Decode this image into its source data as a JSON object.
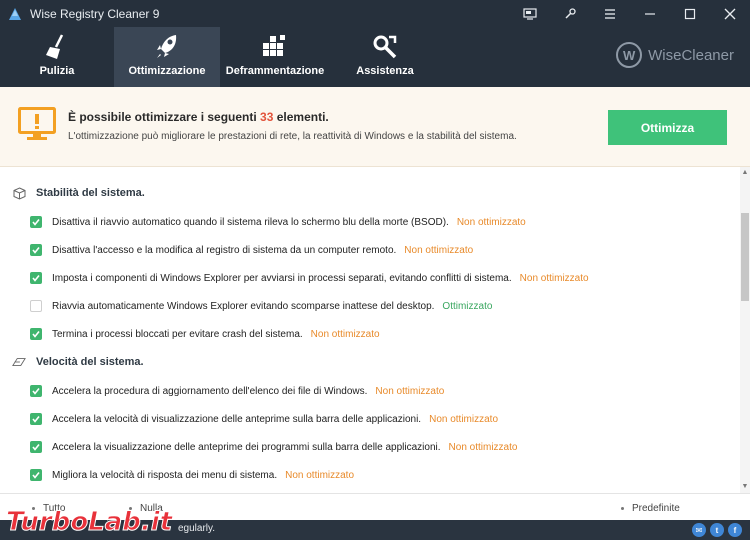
{
  "window": {
    "title": "Wise Registry Cleaner 9",
    "controls": [
      "monitor-icon",
      "skin-icon",
      "menu-icon",
      "minimize-icon",
      "maximize-icon",
      "close-icon"
    ]
  },
  "toolbar": {
    "tabs": [
      {
        "label": "Pulizia",
        "icon": "broom-icon"
      },
      {
        "label": "Ottimizzazione",
        "icon": "rocket-icon",
        "active": true
      },
      {
        "label": "Deframmentazione",
        "icon": "blocks-icon"
      },
      {
        "label": "Assistenza",
        "icon": "tools-icon"
      }
    ],
    "brand": {
      "mark": "W",
      "name": "WiseCleaner"
    }
  },
  "banner": {
    "headline_prefix": "È possibile ottimizzare i seguenti ",
    "count": "33",
    "headline_suffix": " elementi.",
    "description": "L'ottimizzazione può migliorare le prestazioni di rete, la reattività di Windows e la stabilità del sistema.",
    "button_label": "Ottimizza",
    "accent_color": "#3fc27a",
    "warning_color": "#f3a022"
  },
  "sections": [
    {
      "title": "Stabilità del sistema.",
      "icon": "cube-icon",
      "items": [
        {
          "text": "Disattiva il riavvio automatico quando il sistema rileva lo schermo blu della morte (BSOD).",
          "status": "Non ottimizzato",
          "checked": true
        },
        {
          "text": "Disattiva l'accesso e la modifica al registro di sistema da un computer remoto.",
          "status": "Non ottimizzato",
          "checked": true
        },
        {
          "text": "Imposta i componenti di Windows Explorer per avviarsi in processi separati, evitando conflitti di sistema.",
          "status": "Non ottimizzato",
          "checked": true
        },
        {
          "text": "Riavvia automaticamente Windows Explorer evitando scomparse inattese del desktop.",
          "status": "Ottimizzato",
          "checked": false
        },
        {
          "text": "Termina i processi bloccati per evitare crash del sistema.",
          "status": "Non ottimizzato",
          "checked": true
        }
      ]
    },
    {
      "title": "Velocità del sistema.",
      "icon": "speed-icon",
      "items": [
        {
          "text": "Accelera la procedura di aggiornamento dell'elenco dei file di Windows.",
          "status": "Non ottimizzato",
          "checked": true
        },
        {
          "text": "Accelera la velocità di visualizzazione delle anteprime sulla barra delle applicazioni.",
          "status": "Non ottimizzato",
          "checked": true
        },
        {
          "text": "Accelera la visualizzazione delle anteprime dei programmi sulla barra delle applicazioni.",
          "status": "Non ottimizzato",
          "checked": true
        },
        {
          "text": "Migliora la velocità di risposta dei menu di sistema.",
          "status": "Non ottimizzato",
          "checked": true
        }
      ]
    }
  ],
  "footer": {
    "select_all": "Tutto",
    "select_none": "Nulla",
    "defaults": "Predefinite"
  },
  "statusbar": {
    "text": "egularly.",
    "social": [
      "mail-icon",
      "twitter-icon",
      "facebook-icon"
    ]
  },
  "watermark": {
    "text": "TurboLab.it"
  }
}
